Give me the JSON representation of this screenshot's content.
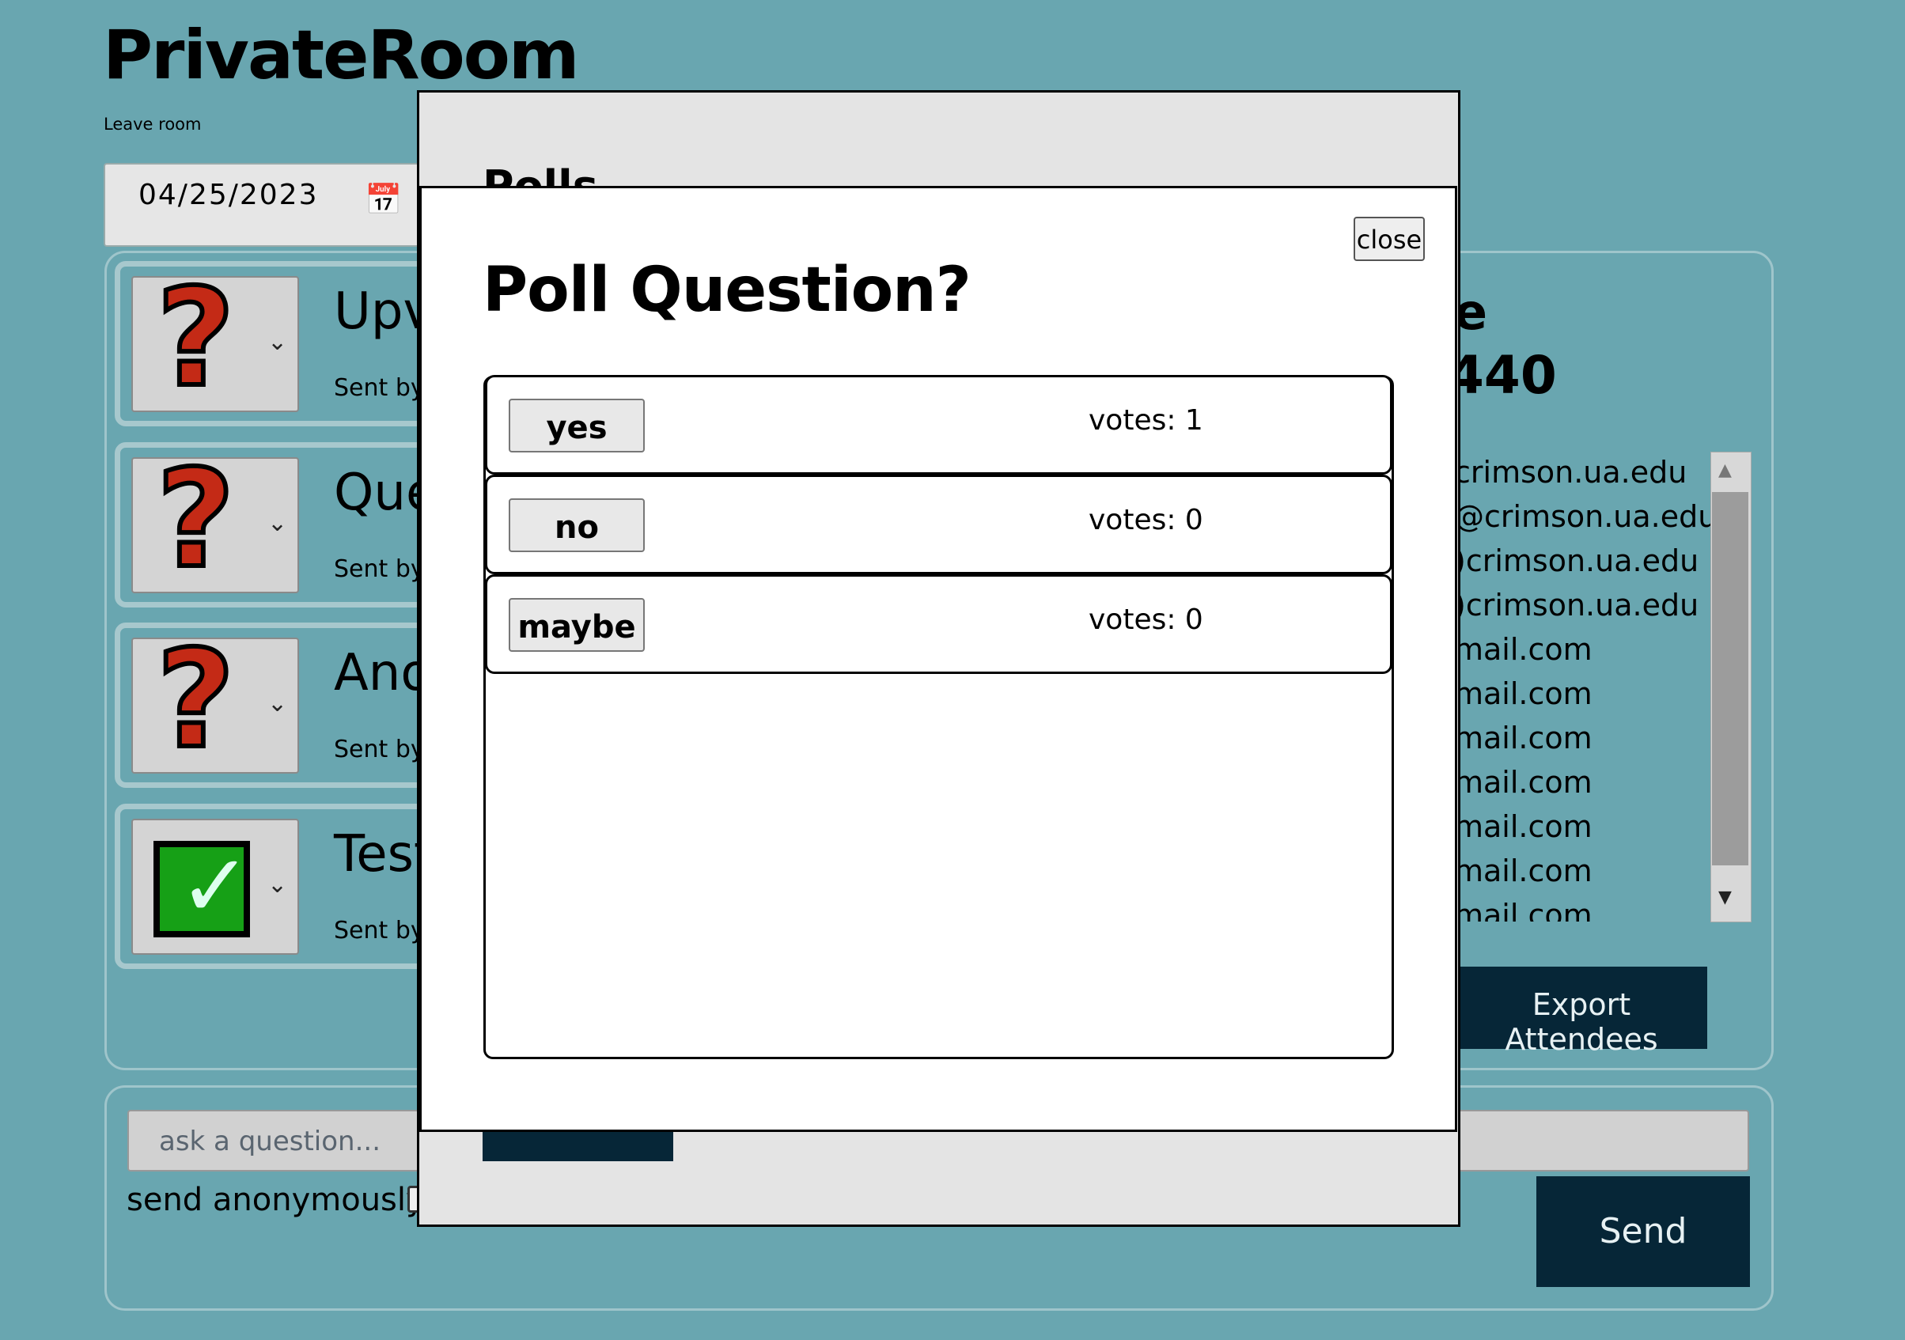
{
  "app": {
    "title": "PrivateRoom",
    "leave_room": "Leave room",
    "date": "04/25/2023",
    "calendar_icon": "calendar-icon"
  },
  "questions": [
    {
      "title": "Upv",
      "sent": "Sent by",
      "icon": "question-mark-icon"
    },
    {
      "title": "Que",
      "sent": "Sent by",
      "icon": "question-mark-icon"
    },
    {
      "title": "Ano",
      "sent": "Sent by",
      "icon": "question-mark-icon"
    },
    {
      "title": "Test",
      "sent": "Sent by",
      "icon": "checkmark-icon"
    }
  ],
  "attendees": {
    "heading_line1": "e",
    "heading_line2": "440",
    "list": [
      "crimson.ua.edu",
      "@crimson.ua.edu",
      ")crimson.ua.edu",
      ")crimson.ua.edu",
      "mail.com",
      "mail.com",
      "mail.com",
      "mail.com",
      "mail.com",
      "mail.com",
      "mail.com"
    ],
    "export_label": "Export Attendees"
  },
  "ask": {
    "placeholder": "ask a question...",
    "anonymous_label": "send anonymously",
    "send_label": "Send"
  },
  "polls_dialog": {
    "title": "Polls"
  },
  "poll_modal": {
    "close_label": "close",
    "question": "Poll Question?",
    "options": [
      {
        "label": "yes",
        "votes": "votes: 1"
      },
      {
        "label": "no",
        "votes": "votes: 0"
      },
      {
        "label": "maybe",
        "votes": "votes: 0"
      }
    ]
  },
  "colors": {
    "background": "#69a6b0",
    "dark_button": "#062637",
    "question_mark": "#c42a16",
    "check_green": "#16a016"
  }
}
